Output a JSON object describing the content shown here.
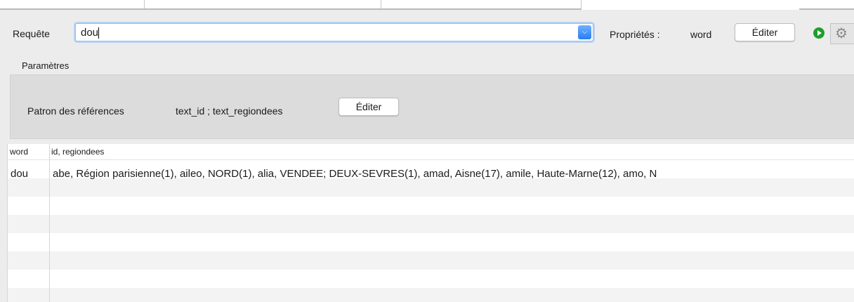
{
  "query": {
    "label": "Requête",
    "value": "dou"
  },
  "properties": {
    "label": "Propriétés :",
    "value": "word",
    "edit_label": "Éditer"
  },
  "parameters": {
    "title": "Paramètres",
    "pattern_label": "Patron des références",
    "pattern_value": "text_id ; text_regiondees",
    "edit_label": "Éditer"
  },
  "table": {
    "columns": [
      "word",
      "id, regiondees"
    ],
    "rows": [
      {
        "word": "dou",
        "refs": "abe, Région parisienne(1), aileo, NORD(1), alia, VENDEE; DEUX-SEVRES(1), amad, Aisne(17), amile, Haute-Marne(12), amo, N"
      }
    ]
  },
  "colors": {
    "accent": "#2b7cf0",
    "run": "#1e9e2e",
    "panel": "#dcdcdc"
  },
  "icons": {
    "dropdown": "chevron-down-icon",
    "run": "play-icon",
    "settings": "gear-icon"
  }
}
